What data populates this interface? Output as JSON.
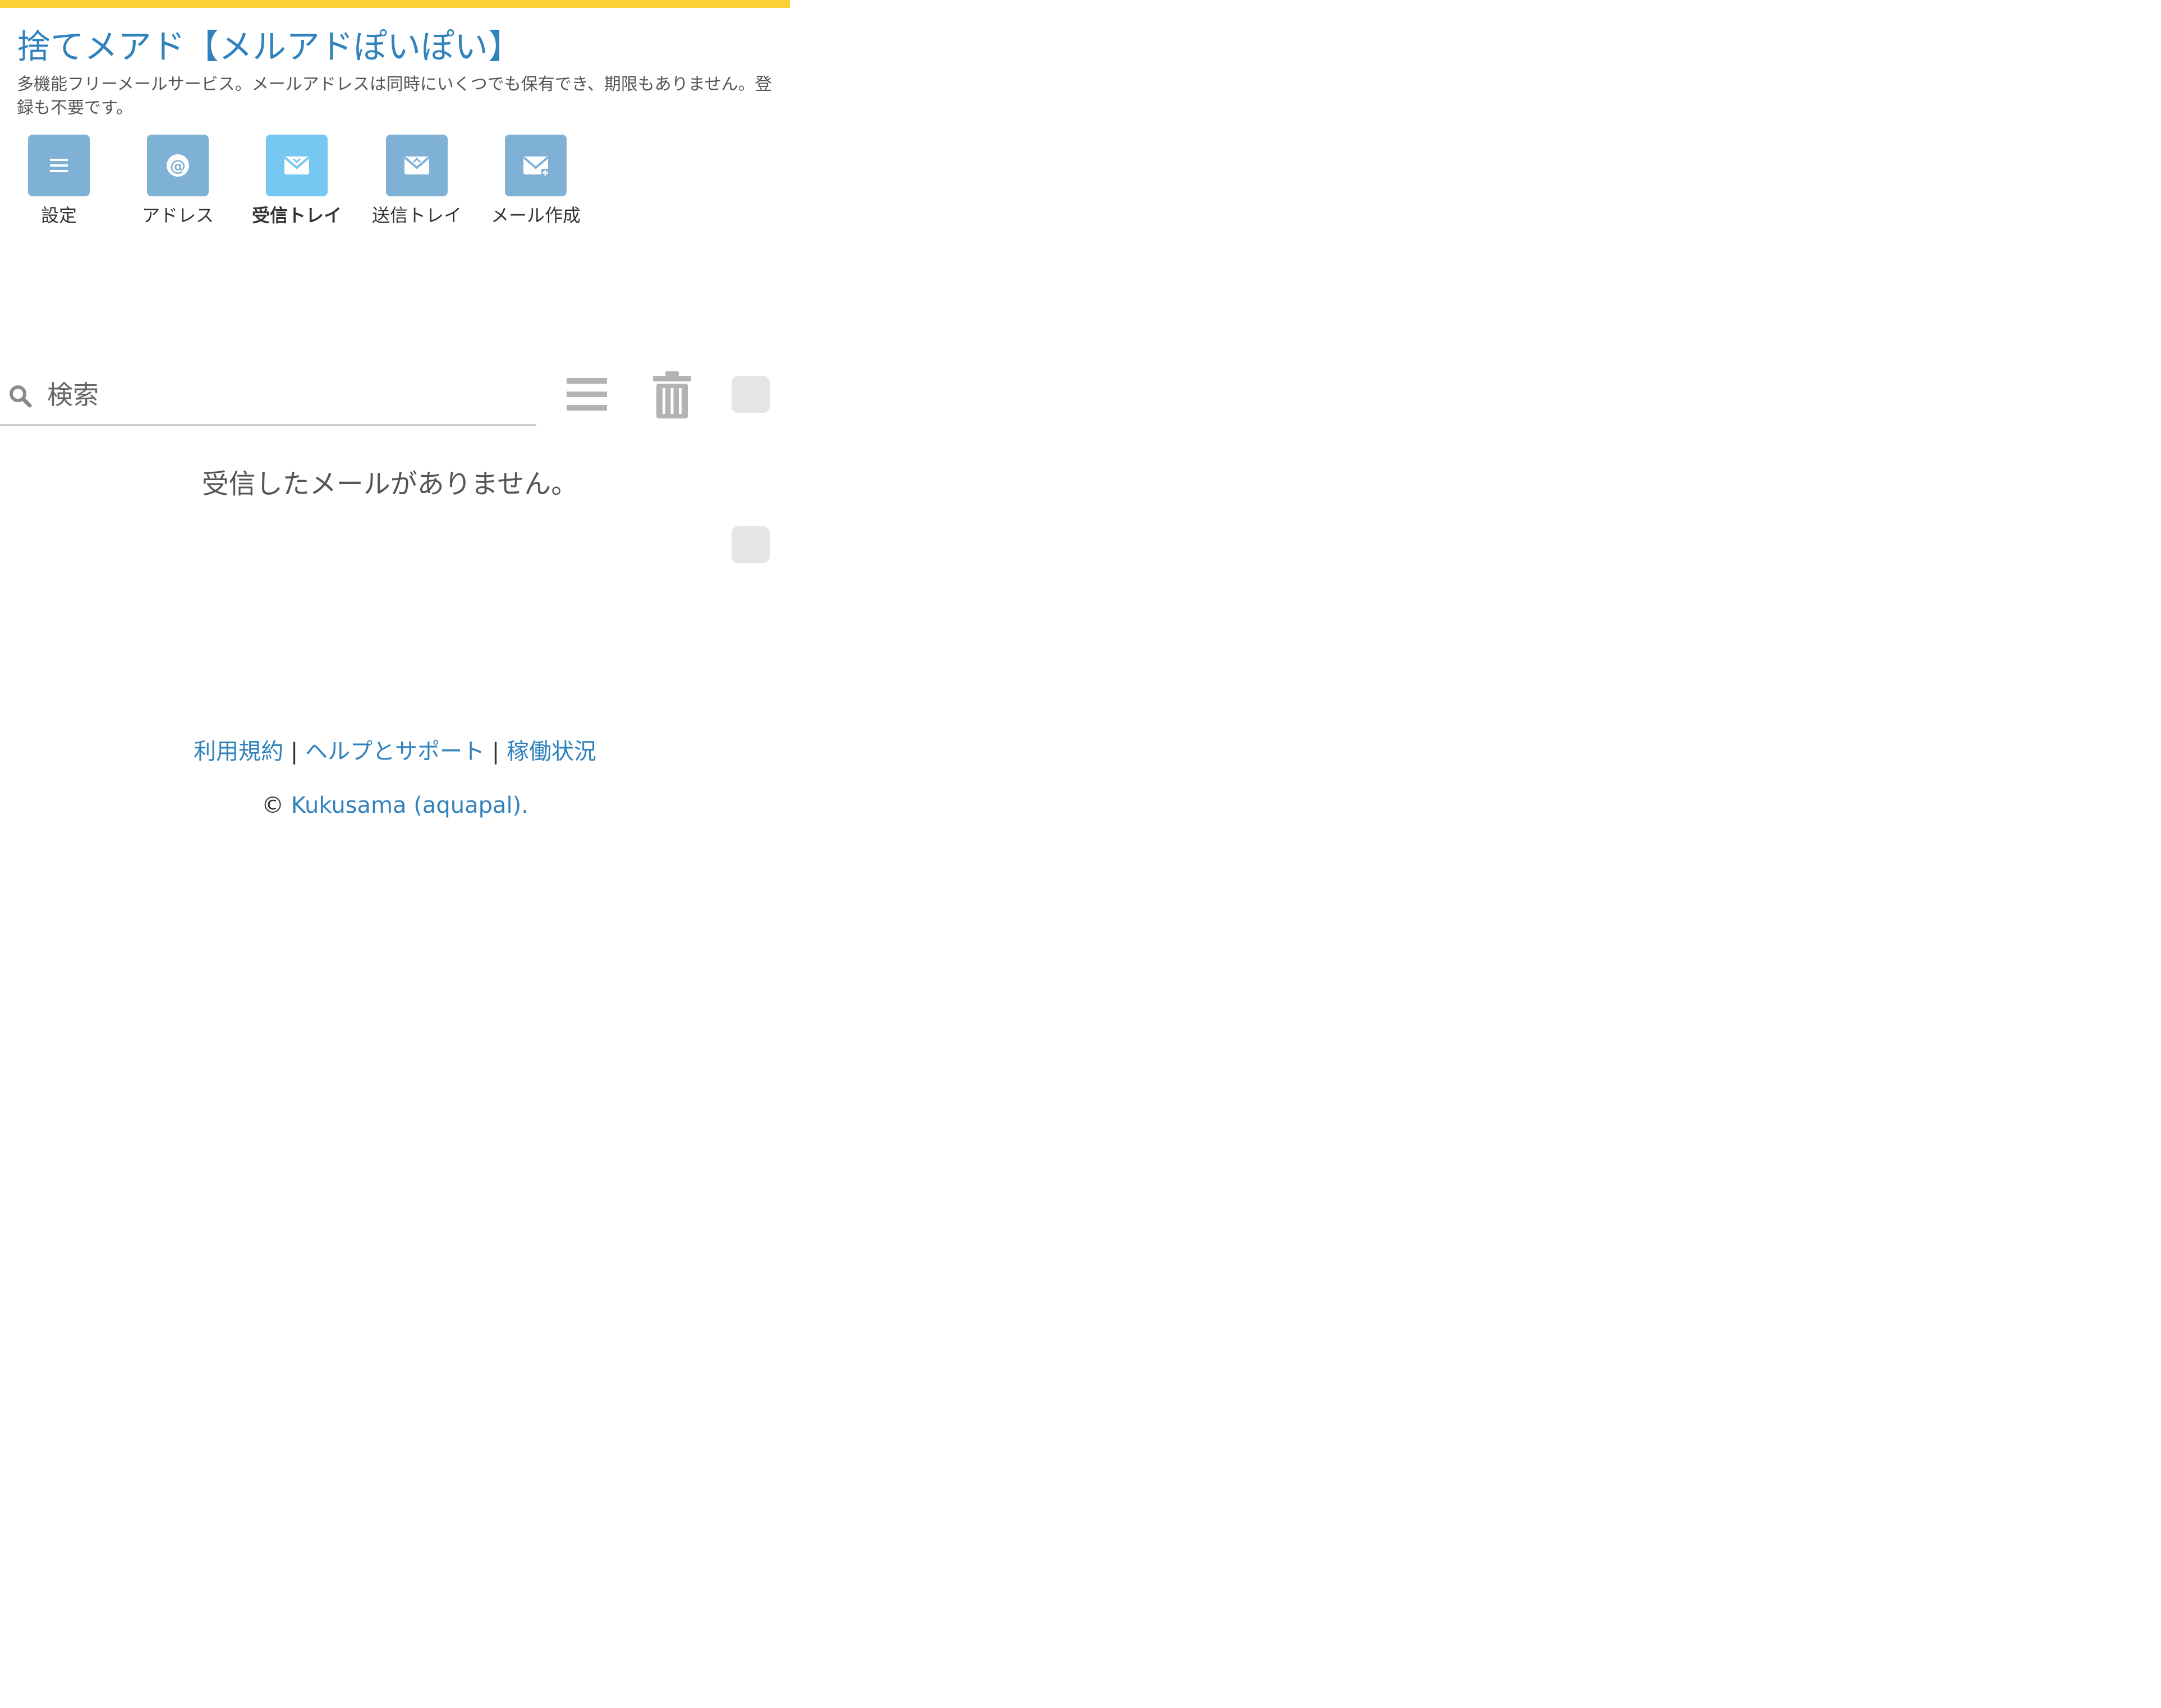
{
  "colors": {
    "accent_bar": "#fcd037",
    "link": "#2f82bc",
    "nav_icon": "#7fb1d6",
    "nav_icon_active": "#76c7f2",
    "tool_icon": "#b3b3b3"
  },
  "header": {
    "title": "捨てメアド【メルアドぽいぽい】",
    "description": "多機能フリーメールサービス。メールアドレスは同時にいくつでも保有でき、期限もありません。登録も不要です。"
  },
  "nav": {
    "items": [
      {
        "label": "設定",
        "icon": "menu-icon"
      },
      {
        "label": "アドレス",
        "icon": "at-sign-icon"
      },
      {
        "label": "受信トレイ",
        "icon": "inbox-envelope-icon",
        "active": true
      },
      {
        "label": "送信トレイ",
        "icon": "outbox-envelope-icon"
      },
      {
        "label": "メール作成",
        "icon": "compose-envelope-icon"
      }
    ]
  },
  "search": {
    "placeholder": "検索",
    "icon": "search-icon"
  },
  "toolbar": {
    "menu_icon": "list-menu-icon",
    "trash_icon": "trash-icon"
  },
  "inbox": {
    "empty_message": "受信したメールがありません。"
  },
  "footer": {
    "links": [
      "利用規約",
      "ヘルプとサポート",
      "稼働状況"
    ],
    "separator": "|",
    "copyright_symbol": "©",
    "copyright_link": "Kukusama (aquapal)."
  }
}
